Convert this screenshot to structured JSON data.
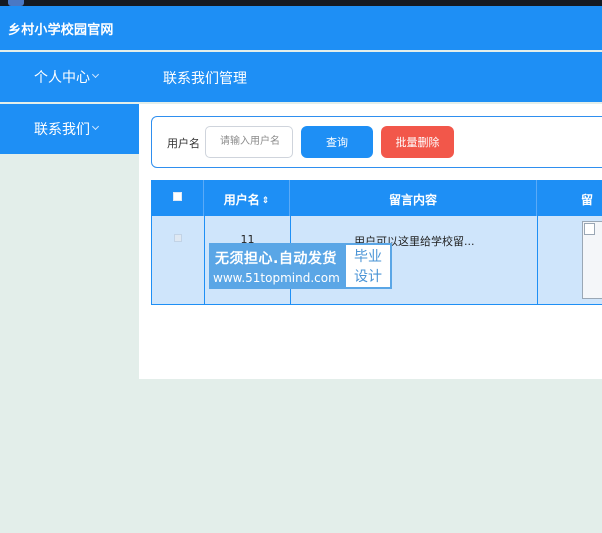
{
  "header": {
    "title": "乡村小学校园官网"
  },
  "nav": {
    "menu_label": "个人中心",
    "breadcrumb": "联系我们管理"
  },
  "sidebar": {
    "items": [
      {
        "label": "联系我们"
      }
    ]
  },
  "search": {
    "label": "用户名",
    "placeholder": "请输入用户名",
    "query_button": "查询",
    "delete_button": "批量删除"
  },
  "table": {
    "columns": [
      "",
      "用户名",
      "留言内容",
      "留"
    ],
    "sort_indicator": "⇕",
    "rows": [
      {
        "username": "11",
        "message": "用户可以这里给学校留..."
      }
    ]
  },
  "watermark": {
    "line1": "无须担心.自动发货",
    "line2": "www.51topmind.com",
    "tag1": "毕业",
    "tag2": "设计"
  },
  "colors": {
    "primary": "#1e8ff5",
    "danger": "#f2574a",
    "background": "#e3eeea",
    "row_highlight": "#cfe5fb"
  }
}
